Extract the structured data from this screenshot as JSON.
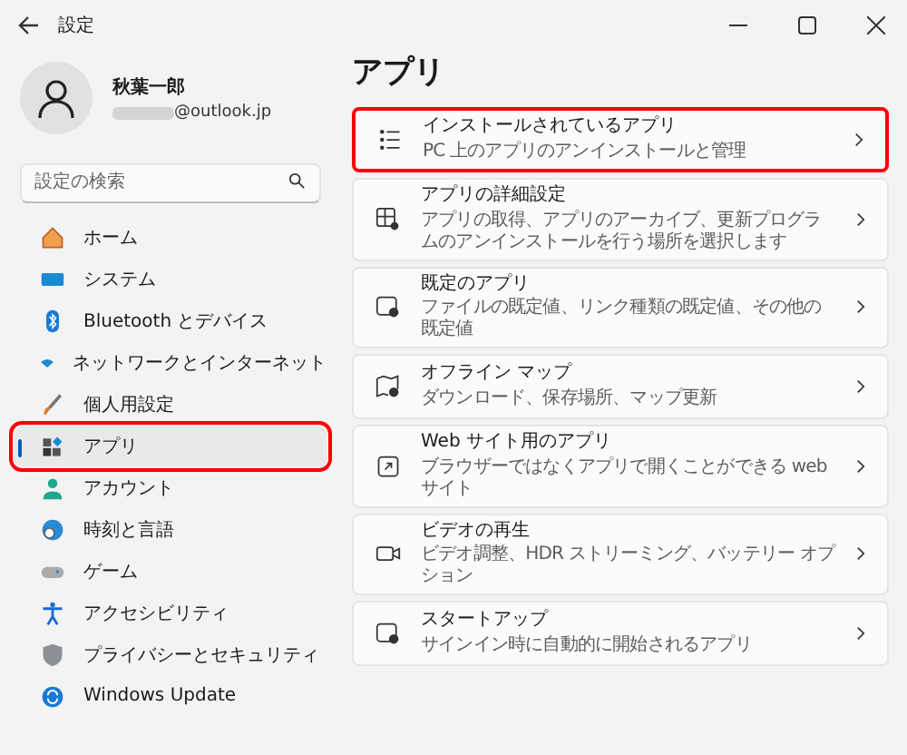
{
  "window": {
    "title": "設定"
  },
  "account": {
    "name": "秋葉一郎",
    "email": "@outlook.jp"
  },
  "search": {
    "placeholder": "設定の検索"
  },
  "sidebar": {
    "items": [
      {
        "label": "ホーム",
        "selected": false,
        "highlighted": false
      },
      {
        "label": "システム",
        "selected": false,
        "highlighted": false
      },
      {
        "label": "Bluetooth とデバイス",
        "selected": false,
        "highlighted": false
      },
      {
        "label": "ネットワークとインターネット",
        "selected": false,
        "highlighted": false
      },
      {
        "label": "個人用設定",
        "selected": false,
        "highlighted": false
      },
      {
        "label": "アプリ",
        "selected": true,
        "highlighted": true
      },
      {
        "label": "アカウント",
        "selected": false,
        "highlighted": false
      },
      {
        "label": "時刻と言語",
        "selected": false,
        "highlighted": false
      },
      {
        "label": "ゲーム",
        "selected": false,
        "highlighted": false
      },
      {
        "label": "アクセシビリティ",
        "selected": false,
        "highlighted": false
      },
      {
        "label": "プライバシーとセキュリティ",
        "selected": false,
        "highlighted": false
      },
      {
        "label": "Windows Update",
        "selected": false,
        "highlighted": false
      }
    ]
  },
  "page": {
    "title": "アプリ",
    "items": [
      {
        "title": "インストールされているアプリ",
        "subtitle": "PC 上のアプリのアンインストールと管理",
        "highlighted": true
      },
      {
        "title": "アプリの詳細設定",
        "subtitle": "アプリの取得、アプリのアーカイブ、更新プログラムのアンインストールを行う場所を選択します",
        "highlighted": false
      },
      {
        "title": "既定のアプリ",
        "subtitle": "ファイルの既定値、リンク種類の既定値、その他の既定値",
        "highlighted": false
      },
      {
        "title": "オフライン マップ",
        "subtitle": "ダウンロード、保存場所、マップ更新",
        "highlighted": false
      },
      {
        "title": "Web サイト用のアプリ",
        "subtitle": "ブラウザーではなくアプリで開くことができる web サイト",
        "highlighted": false
      },
      {
        "title": "ビデオの再生",
        "subtitle": "ビデオ調整、HDR ストリーミング、バッテリー オプション",
        "highlighted": false
      },
      {
        "title": "スタートアップ",
        "subtitle": "サインイン時に自動的に開始されるアプリ",
        "highlighted": false
      }
    ]
  }
}
